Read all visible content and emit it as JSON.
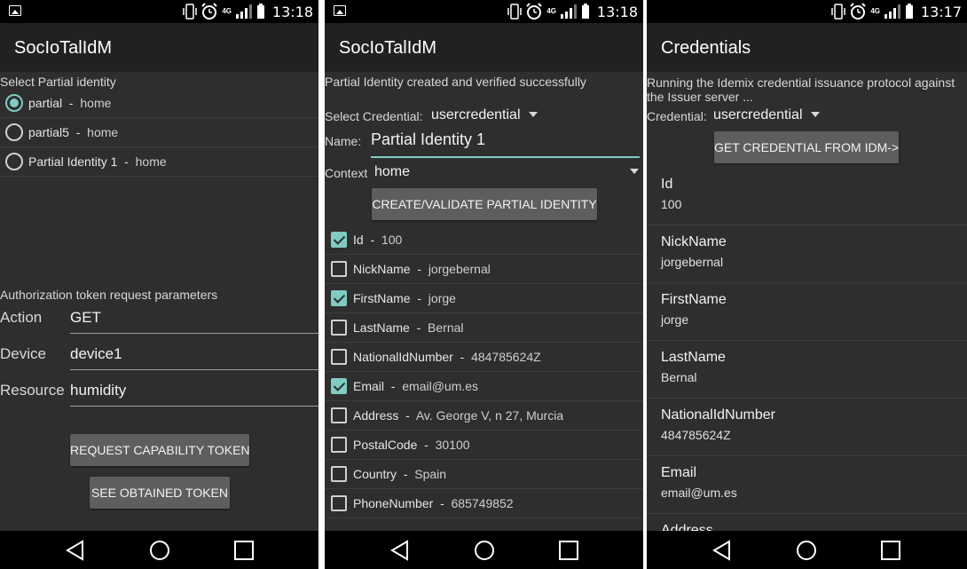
{
  "status": {
    "time_left": "13:18",
    "time_middle": "13:18",
    "time_right": "13:17",
    "network": "4G"
  },
  "screen1": {
    "app_title": "SocIoTalIdM",
    "select_label": "Select Partial identity",
    "identities": [
      {
        "name": "partial",
        "context": "home",
        "selected": true
      },
      {
        "name": "partial5",
        "context": "home",
        "selected": false
      },
      {
        "name": "Partial Identity 1",
        "context": "home",
        "selected": false
      }
    ],
    "separator": "-",
    "auth_label": "Authorization token request parameters",
    "action_label": "Action",
    "action_value": "GET",
    "device_label": "Device",
    "device_value": "device1",
    "resource_label": "Resource",
    "resource_value": "humidity",
    "request_button": "REQUEST CAPABILITY TOKEN",
    "see_button": "SEE OBTAINED TOKEN"
  },
  "screen2": {
    "app_title": "SocIoTalIdM",
    "status_msg": "Partial Identity created and verified successfully",
    "select_credential_label": "Select Credential:",
    "credential_value": "usercredential",
    "name_label": "Name:",
    "name_value": "Partial Identity 1",
    "context_label": "Context",
    "context_value": "home",
    "create_button": "CREATE/VALIDATE PARTIAL IDENTITY",
    "attributes": [
      {
        "name": "Id",
        "value": "100",
        "checked": true
      },
      {
        "name": "NickName",
        "value": "jorgebernal",
        "checked": false
      },
      {
        "name": "FirstName",
        "value": "jorge",
        "checked": true
      },
      {
        "name": "LastName",
        "value": "Bernal",
        "checked": false
      },
      {
        "name": "NationalIdNumber",
        "value": "484785624Z",
        "checked": false
      },
      {
        "name": "Email",
        "value": "email@um.es",
        "checked": true
      },
      {
        "name": "Address",
        "value": "Av. George V, n 27, Murcia",
        "checked": false
      },
      {
        "name": "PostalCode",
        "value": "30100",
        "checked": false
      },
      {
        "name": "Country",
        "value": "Spain",
        "checked": false
      },
      {
        "name": "PhoneNumber",
        "value": "685749852",
        "checked": false
      }
    ]
  },
  "screen3": {
    "title": "Credentials",
    "running_msg": "Running the Idemix credential issuance protocol against the Issuer server ...",
    "credential_label": "Credential:",
    "credential_value": "usercredential",
    "get_button": "GET CREDENTIAL FROM IDM->",
    "fields": [
      {
        "name": "Id",
        "value": "100"
      },
      {
        "name": "NickName",
        "value": "jorgebernal"
      },
      {
        "name": "FirstName",
        "value": "jorge"
      },
      {
        "name": "LastName",
        "value": "Bernal"
      },
      {
        "name": "NationalIdNumber",
        "value": "484785624Z"
      },
      {
        "name": "Email",
        "value": "email@um.es"
      },
      {
        "name": "Address",
        "value": ""
      }
    ]
  },
  "colors": {
    "accent": "#80cbc4",
    "background": "#2e2e2e",
    "actionbar": "#212121",
    "button": "#5e5e5e"
  },
  "icons": [
    "image-icon",
    "phone-vibrate-icon",
    "alarm-icon",
    "network-4g-icon",
    "signal-icon",
    "battery-icon",
    "back-icon",
    "home-icon",
    "recents-icon",
    "dropdown-arrow-icon"
  ]
}
